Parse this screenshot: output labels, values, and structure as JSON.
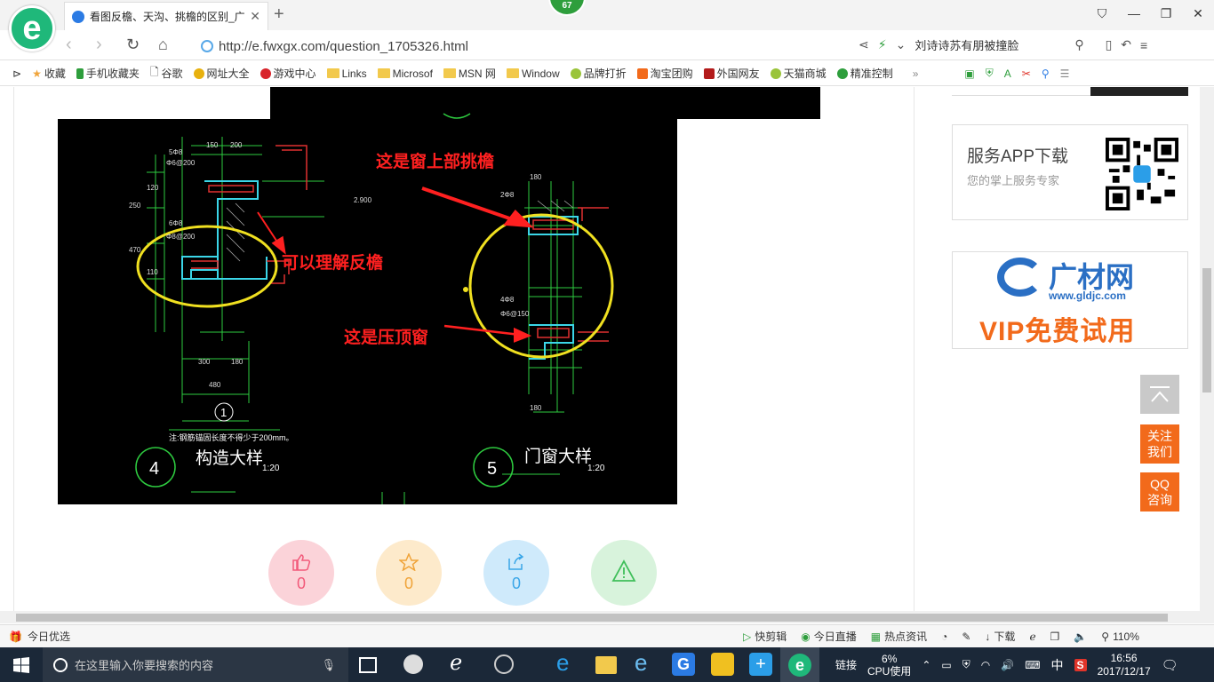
{
  "browser": {
    "tab_title": "看图反檐、天沟、挑檐的区别_广",
    "badge_count": "67",
    "url": "http://e.fwxgx.com/question_1705326.html",
    "search_text": "刘诗诗苏有朋被撞脸"
  },
  "bookmarks": [
    "收藏",
    "手机收藏夹",
    "谷歌",
    "网址大全",
    "游戏中心",
    "Links",
    "Microsof",
    "MSN 网",
    "Window",
    "品牌打折",
    "淘宝团购",
    "外国网友",
    "天猫商城",
    "精准控制"
  ],
  "cad": {
    "annotation_top": "这是窗上部挑檐",
    "annotation_left": "可以理解反檐",
    "annotation_bottom": "这是压顶窗",
    "detail_left_number": "4",
    "detail_left_title": "构造大样",
    "detail_left_scale": "1:20",
    "detail_right_number": "5",
    "detail_right_title": "门窗大样",
    "detail_right_scale": "1:20",
    "note": "注:钢筋锚固长度不得少于200mm。",
    "circle_label": "1",
    "dims": [
      "150",
      "200",
      "2.900",
      "5Φ8",
      "Φ6@200",
      "6Φ8",
      "Φ8@200",
      "250",
      "470",
      "120",
      "110",
      "300",
      "180",
      "480",
      "2Φ8",
      "180",
      "4Φ8",
      "Φ6@150",
      "180"
    ]
  },
  "sidebar": {
    "app_title": "服务APP下载",
    "app_subtitle": "您的掌上服务专家",
    "ad_brand": "广材网",
    "ad_site": "www.gldjc.com",
    "ad_slogan": "VIP免费试用",
    "follow_label": "关注我们",
    "qq_label": "QQ咨询"
  },
  "actions": [
    {
      "name": "like",
      "count": "0",
      "color": "#fbd3d9",
      "fg": "#f25a7a"
    },
    {
      "name": "favorite",
      "count": "0",
      "color": "#fdeacb",
      "fg": "#f0a43a"
    },
    {
      "name": "share",
      "count": "0",
      "color": "#cfeafb",
      "fg": "#3aa6e8"
    },
    {
      "name": "report",
      "count": "",
      "color": "#d8f3dc",
      "fg": "#3fbf5a"
    }
  ],
  "statusbar": {
    "left": "今日优选",
    "items": [
      "快剪辑",
      "今日直播",
      "热点资讯",
      "下载"
    ],
    "zoom": "110%"
  },
  "taskbar": {
    "search_placeholder": "在这里输入你要搜索的内容",
    "tray_link": "链接",
    "cpu_percent": "6%",
    "cpu_label": "CPU使用",
    "ime": "中",
    "time": "16:56",
    "date": "2017/12/17"
  }
}
